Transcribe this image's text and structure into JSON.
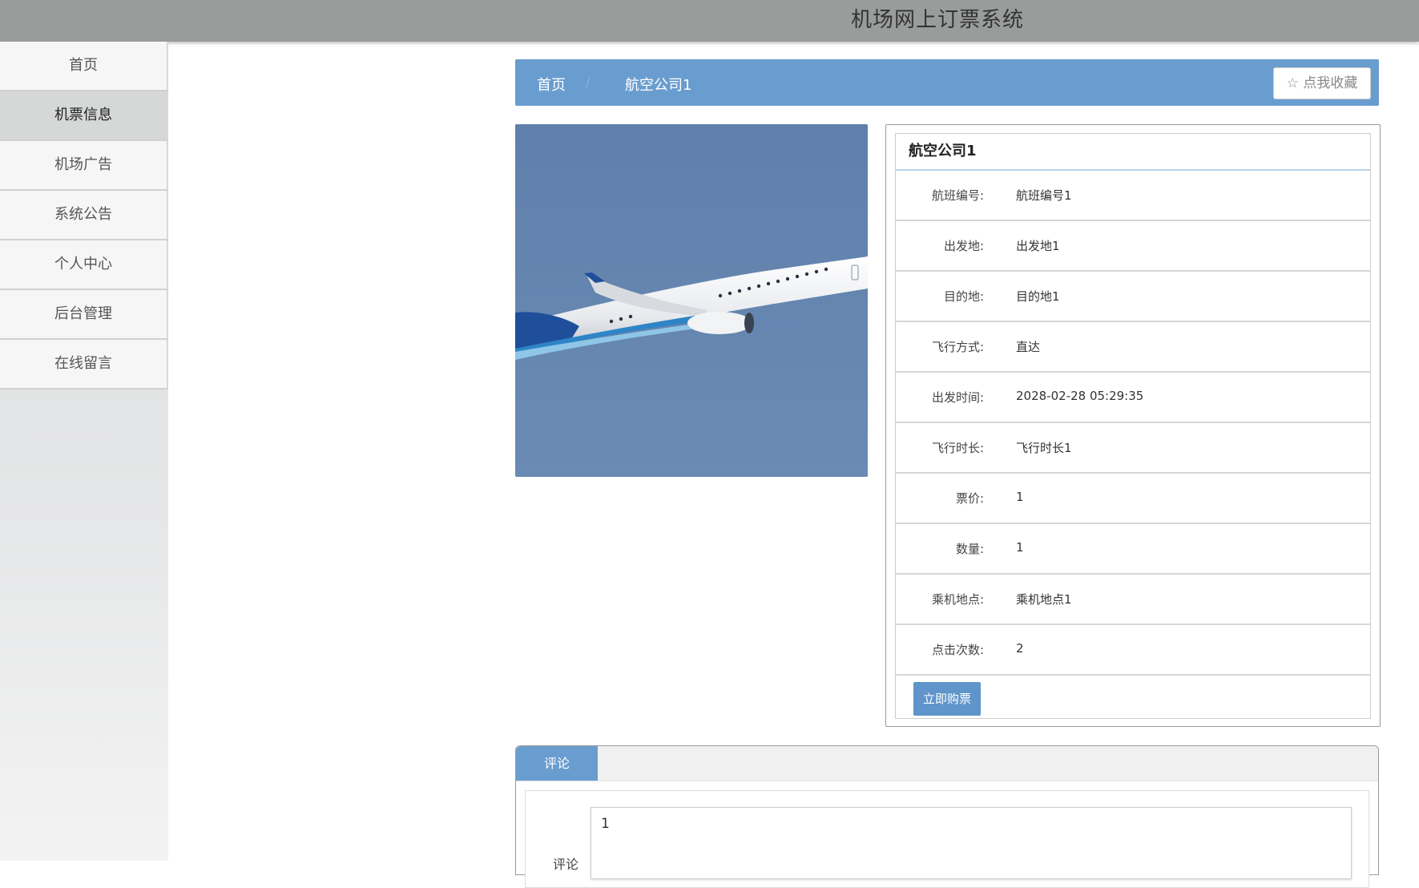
{
  "app": {
    "title": "机场网上订票系统"
  },
  "sidebar": {
    "items": [
      {
        "label": "首页"
      },
      {
        "label": "机票信息"
      },
      {
        "label": "机场广告"
      },
      {
        "label": "系统公告"
      },
      {
        "label": "个人中心"
      },
      {
        "label": "后台管理"
      },
      {
        "label": "在线留言"
      }
    ],
    "active_index": 1
  },
  "breadcrumb": {
    "home": "首页",
    "separator": "/",
    "current": "航空公司1",
    "favorite_label": "点我收藏"
  },
  "photo": {
    "subject": "airplane-in-flight"
  },
  "detail": {
    "title": "航空公司1",
    "rows": [
      {
        "label": "航班编号:",
        "value": "航班编号1"
      },
      {
        "label": "出发地:",
        "value": "出发地1"
      },
      {
        "label": "目的地:",
        "value": "目的地1"
      },
      {
        "label": "飞行方式:",
        "value": "直达"
      },
      {
        "label": "出发时间:",
        "value": "2028-02-28 05:29:35"
      },
      {
        "label": "飞行时长:",
        "value": "飞行时长1"
      },
      {
        "label": "票价:",
        "value": "1"
      },
      {
        "label": "数量:",
        "value": "1"
      },
      {
        "label": "乘机地点:",
        "value": "乘机地点1"
      },
      {
        "label": "点击次数:",
        "value": "2"
      }
    ],
    "buy_label": "立即购票"
  },
  "comments": {
    "tab_label": "评论",
    "field_label": "评论",
    "input_value": "1"
  },
  "colors": {
    "topbar": "#999c9b",
    "accent_blue": "#6a9dcf",
    "button_blue": "#5f95ca"
  }
}
